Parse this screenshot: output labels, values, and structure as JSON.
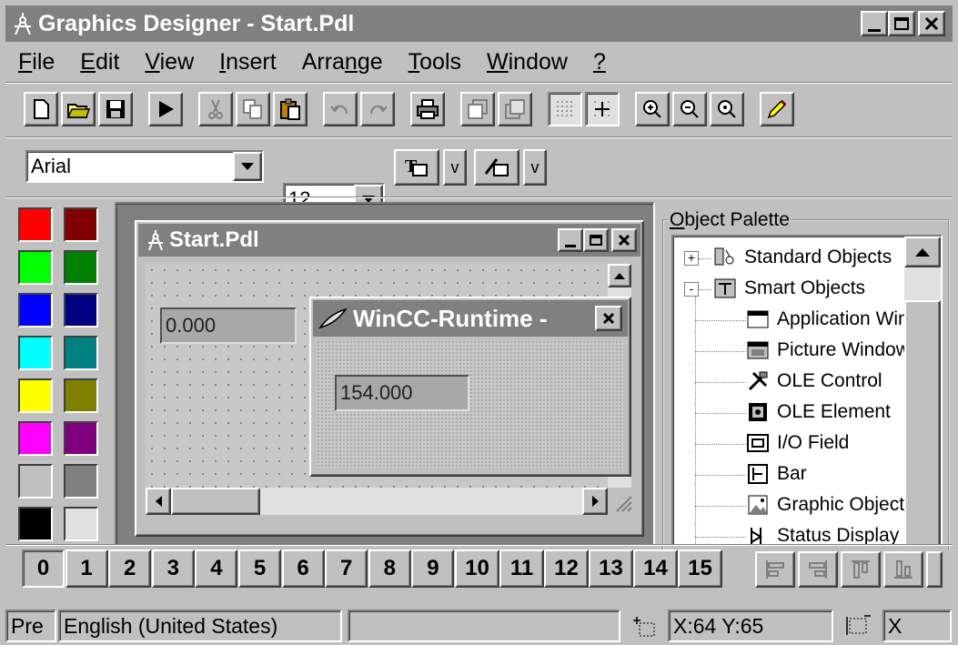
{
  "window": {
    "title": "Graphics Designer - Start.Pdl"
  },
  "menu": [
    {
      "label": "File",
      "u": "F",
      "rest": "ile"
    },
    {
      "label": "Edit",
      "u": "E",
      "rest": "dit"
    },
    {
      "label": "View",
      "u": "V",
      "rest": "iew"
    },
    {
      "label": "Insert",
      "u": "I",
      "rest": "nsert"
    },
    {
      "label": "Arrange",
      "pre": "Arra",
      "u": "n",
      "rest": "ge"
    },
    {
      "label": "Tools",
      "u": "T",
      "rest": "ools"
    },
    {
      "label": "Window",
      "u": "W",
      "rest": "indow"
    },
    {
      "label": "?",
      "u": "?",
      "rest": ""
    }
  ],
  "format": {
    "font": "Arial",
    "size": "12",
    "v1": "v",
    "v2": "v"
  },
  "colors": {
    "left": [
      "#ff0000",
      "#00ff00",
      "#0000ff",
      "#00ffff",
      "#ffff00",
      "#ff00ff",
      "#c0c0c0",
      "#000000"
    ],
    "right": [
      "#800000",
      "#008000",
      "#000080",
      "#008080",
      "#808000",
      "#800080",
      "#808080",
      "#e0e0e0"
    ]
  },
  "start_window": {
    "title": "Start.Pdl",
    "value": "0.000"
  },
  "runtime_window": {
    "title": "WinCC-Runtime -",
    "value": "154.000"
  },
  "palette": {
    "title": "Object Palette",
    "items": [
      {
        "label": "Standard Objects",
        "icon": "standard-objects-icon",
        "level": 0,
        "expander": "+"
      },
      {
        "label": "Smart Objects",
        "icon": "smart-objects-icon",
        "level": 0,
        "expander": "-"
      },
      {
        "label": "Application Window",
        "icon": "application-window-icon",
        "level": 1
      },
      {
        "label": "Picture Window",
        "icon": "picture-window-icon",
        "level": 1
      },
      {
        "label": "OLE Control",
        "icon": "ole-control-icon",
        "level": 1
      },
      {
        "label": "OLE Element",
        "icon": "ole-element-icon",
        "level": 1
      },
      {
        "label": "I/O Field",
        "icon": "io-field-icon",
        "level": 1
      },
      {
        "label": "Bar",
        "icon": "bar-icon",
        "level": 1
      },
      {
        "label": "Graphic Object",
        "icon": "graphic-object-icon",
        "level": 1
      },
      {
        "label": "Status Display",
        "icon": "status-display-icon",
        "level": 1
      }
    ]
  },
  "layers": [
    "0",
    "1",
    "2",
    "3",
    "4",
    "5",
    "6",
    "7",
    "8",
    "9",
    "10",
    "11",
    "12",
    "13",
    "14",
    "15"
  ],
  "status": {
    "left": "Pre",
    "language": "English (United States)",
    "coords": "X:64 Y:65",
    "x_text": "X"
  }
}
